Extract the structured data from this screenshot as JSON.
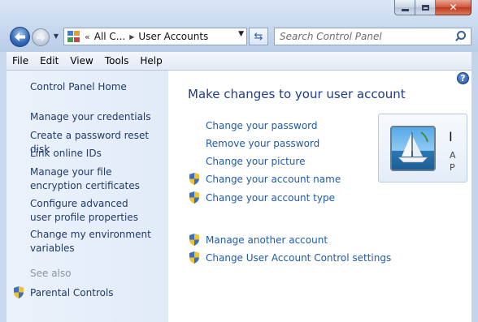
{
  "window": {
    "minimize_glyph": "minimize-icon",
    "maximize_glyph": "maximize-icon",
    "close_label": "✕"
  },
  "nav": {
    "breadcrumb_overflow": "«",
    "breadcrumbs": [
      "All C...",
      "User Accounts"
    ],
    "search_placeholder": "Search Control Panel"
  },
  "menu": [
    "File",
    "Edit",
    "View",
    "Tools",
    "Help"
  ],
  "sidebar": {
    "home": "Control Panel Home",
    "tasks": [
      "Manage your credentials",
      "Create a password reset disk",
      "Link online IDs",
      "Manage your file encryption certificates",
      "Configure advanced user profile properties",
      "Change my environment variables"
    ],
    "see_also_label": "See also",
    "see_also": [
      "Parental Controls"
    ]
  },
  "main": {
    "title": "Make changes to your user account",
    "links": [
      "Change your password",
      "Remove your password",
      "Change your picture",
      "Change your account name",
      "Change your account type"
    ],
    "other_links": [
      "Manage another account",
      "Change User Account Control settings"
    ],
    "account": {
      "name": "I",
      "type": "A",
      "protection": "P"
    }
  },
  "colors": {
    "link": "#1e5baa",
    "title": "#1e3c8a",
    "sidebar_link": "#1f3a68",
    "see_also": "#8a94a2"
  }
}
